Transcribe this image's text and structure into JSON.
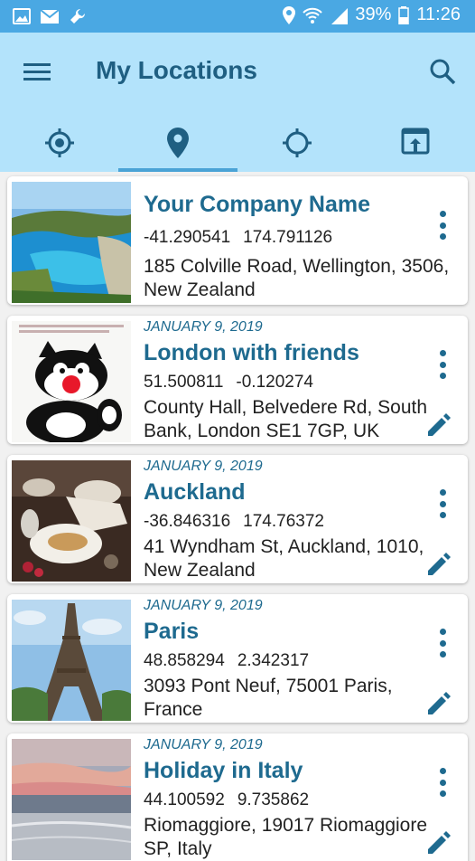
{
  "status_bar": {
    "left_icons": [
      "image-icon",
      "mail-icon",
      "wrench-icon"
    ],
    "right_icons": [
      "location-icon",
      "wifi-icon",
      "signal-icon",
      "battery-icon"
    ],
    "battery": "39%",
    "time": "11:26"
  },
  "app_bar": {
    "title": "My Locations",
    "menu_icon": "menu-icon",
    "search_icon": "search-icon"
  },
  "tabs": [
    {
      "icon": "gps-fixed-icon",
      "selected": false
    },
    {
      "icon": "place-pin-icon",
      "selected": true
    },
    {
      "icon": "gps-not-fixed-icon",
      "selected": false
    },
    {
      "icon": "open-in-browser-icon",
      "selected": false
    }
  ],
  "locations": [
    {
      "date": "",
      "name": "Your Company Name",
      "lat": "-41.290541",
      "lng": "174.791126",
      "address": "185 Colville Road, Wellington, 3506, New Zealand",
      "thumb": "beach-cliff-photo",
      "editable": false
    },
    {
      "date": "JANUARY 9, 2019",
      "name": "London with friends",
      "lat": "51.500811",
      "lng": "-0.120274",
      "address": "County Hall, Belvedere Rd, South Bank, London SE1 7GP, UK",
      "thumb": "cartoon-cat-photo",
      "editable": true
    },
    {
      "date": "JANUARY 9, 2019",
      "name": "Auckland",
      "lat": "-36.846316",
      "lng": "174.76372",
      "address": "41 Wyndham St, Auckland, 1010, New Zealand",
      "thumb": "dinner-table-photo",
      "editable": true
    },
    {
      "date": "JANUARY 9, 2019",
      "name": "Paris",
      "lat": "48.858294",
      "lng": "2.342317",
      "address": "3093 Pont Neuf, 75001 Paris, France",
      "thumb": "eiffel-tower-photo",
      "editable": true
    },
    {
      "date": "JANUARY 9, 2019",
      "name": "Holiday in Italy",
      "lat": "44.100592",
      "lng": "9.735862",
      "address": "Riomaggiore, 19017 Riomaggiore SP, Italy",
      "thumb": "seaside-sunset-photo",
      "editable": true
    }
  ],
  "colors": {
    "status_bar": "#4aa8e3",
    "app_bar": "#b3e3fb",
    "accent": "#1e6a8f"
  }
}
